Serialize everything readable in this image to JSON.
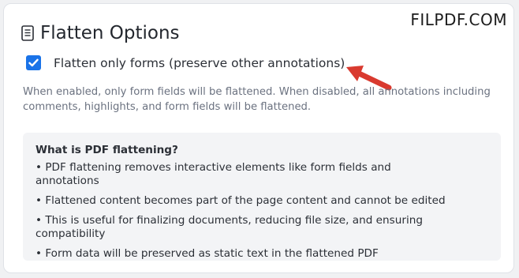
{
  "watermark": "FILPDF.COM",
  "section": {
    "title": "Flatten Options",
    "icon": "document-icon"
  },
  "option": {
    "checked": true,
    "label": "Flatten only forms (preserve other annotations)"
  },
  "description": "When enabled, only form fields will be flattened. When disabled, all annotations including comments, highlights, and form fields will be flattened.",
  "info": {
    "title": "What is PDF flattening?",
    "items": [
      "• PDF flattening removes interactive elements like form fields and annotations",
      "• Flattened content becomes part of the page content and cannot be edited",
      "• This is useful for finalizing documents, reducing file size, and ensuring compatibility",
      "• Form data will be preserved as static text in the flattened PDF"
    ]
  },
  "colors": {
    "accent": "#1a73e8",
    "arrow": "#d93a2f"
  }
}
